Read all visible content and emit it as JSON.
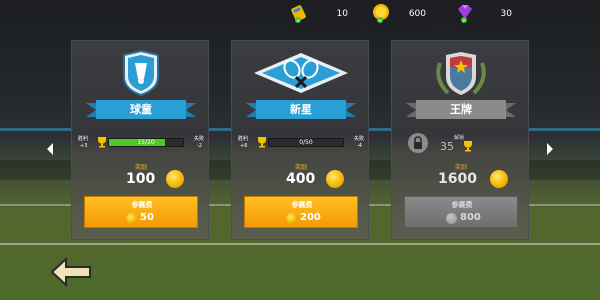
{
  "resources": {
    "tickets": "10",
    "coins": "600",
    "gems": "30"
  },
  "cards": [
    {
      "title": "球童",
      "emblem": "shield-shuttlecock-icon",
      "win_label": "胜利",
      "win_value": "+3",
      "lose_label": "失败",
      "lose_value": "-2",
      "progress_text": "15/20",
      "progress": 0.75,
      "reward_label": "奖励",
      "reward_value": "100",
      "entry_label": "参赛费",
      "entry_value": "50"
    },
    {
      "title": "新星",
      "emblem": "crossed-rackets-icon",
      "win_label": "胜利",
      "win_value": "+6",
      "lose_label": "失败",
      "lose_value": "-4",
      "progress_text": "0/50",
      "progress": 0,
      "reward_label": "奖励",
      "reward_value": "400",
      "entry_label": "参赛费",
      "entry_value": "200"
    },
    {
      "title": "王牌",
      "emblem": "star-shield-laurel-icon",
      "unlock_label": "解锁",
      "unlock_value": "35",
      "reward_label": "奖励",
      "reward_value": "1600",
      "entry_label": "参赛费",
      "entry_value": "800"
    }
  ],
  "colors": {
    "accent_blue": "#2a9fd6",
    "entry_orange": "#f7a812",
    "progress_green": "#4ec928",
    "coin_gold": "#f4b400"
  }
}
